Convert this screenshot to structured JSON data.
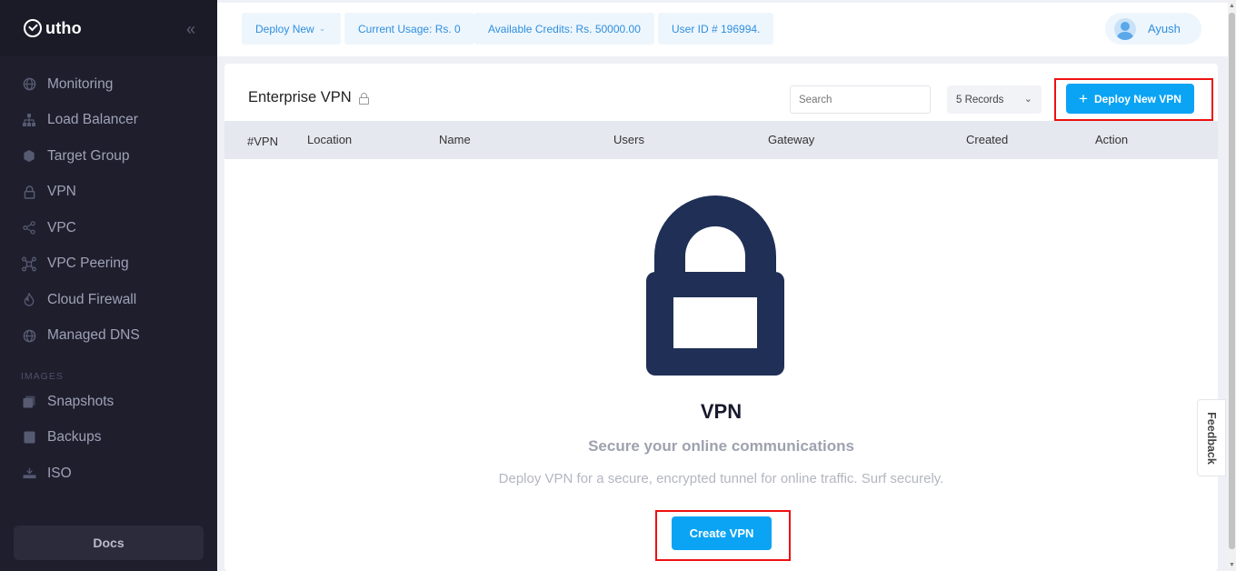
{
  "brand": {
    "name": "utho"
  },
  "sidebar": {
    "collapse_glyph": "«",
    "items": [
      {
        "label": "Monitoring",
        "icon": "globe-icon"
      },
      {
        "label": "Load Balancer",
        "icon": "load-balancer-icon"
      },
      {
        "label": "Target Group",
        "icon": "cube-icon"
      },
      {
        "label": "VPN",
        "icon": "lock-icon"
      },
      {
        "label": "VPC",
        "icon": "share-icon"
      },
      {
        "label": "VPC Peering",
        "icon": "network-icon"
      },
      {
        "label": "Cloud Firewall",
        "icon": "fire-icon"
      },
      {
        "label": "Managed DNS",
        "icon": "globe-icon"
      }
    ],
    "section_images": "IMAGES",
    "image_items": [
      {
        "label": "Snapshots",
        "icon": "snapshot-icon"
      },
      {
        "label": "Backups",
        "icon": "backup-icon"
      },
      {
        "label": "ISO",
        "icon": "iso-icon"
      }
    ],
    "docs_label": "Docs"
  },
  "topbar": {
    "deploy_new": "Deploy New",
    "current_usage": "Current Usage: Rs. 0",
    "available_credits": "Available Credits: Rs. 50000.00",
    "user_id": "User ID # 196994.",
    "user_name": "Ayush"
  },
  "main": {
    "title": "Enterprise VPN",
    "search_placeholder": "Search",
    "records": "5 Records",
    "deploy_button": "Deploy New VPN",
    "columns": [
      "#VPN",
      "Location",
      "Name",
      "Users",
      "Gateway",
      "Created",
      "Action"
    ],
    "empty": {
      "heading": "VPN",
      "subheading": "Secure your online communications",
      "description": "Deploy VPN for a secure, encrypted tunnel for online traffic. Surf securely.",
      "button": "Create VPN"
    }
  },
  "feedback_label": "Feedback",
  "colors": {
    "accent": "#0ba4f4",
    "sidebar_bg": "#1e1e2d",
    "lock": "#1f2f56",
    "highlight": "#ee1111"
  }
}
